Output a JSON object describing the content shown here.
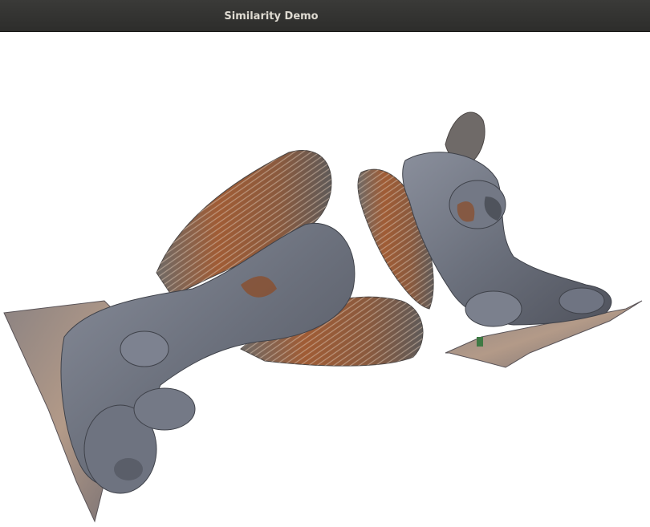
{
  "window": {
    "title": "Similarity Demo"
  },
  "viewport": {
    "background": "#ffffff",
    "models": [
      "griffin-statue-left",
      "griffin-statue-right"
    ]
  },
  "colors": {
    "titlebar": "#2f2f2d",
    "title_text": "#dfdbd2",
    "stone_gray": "#7b8190",
    "stone_dark": "#4a4e58",
    "wood_brown": "#9a5a35",
    "base_tan": "#a48e7e"
  }
}
